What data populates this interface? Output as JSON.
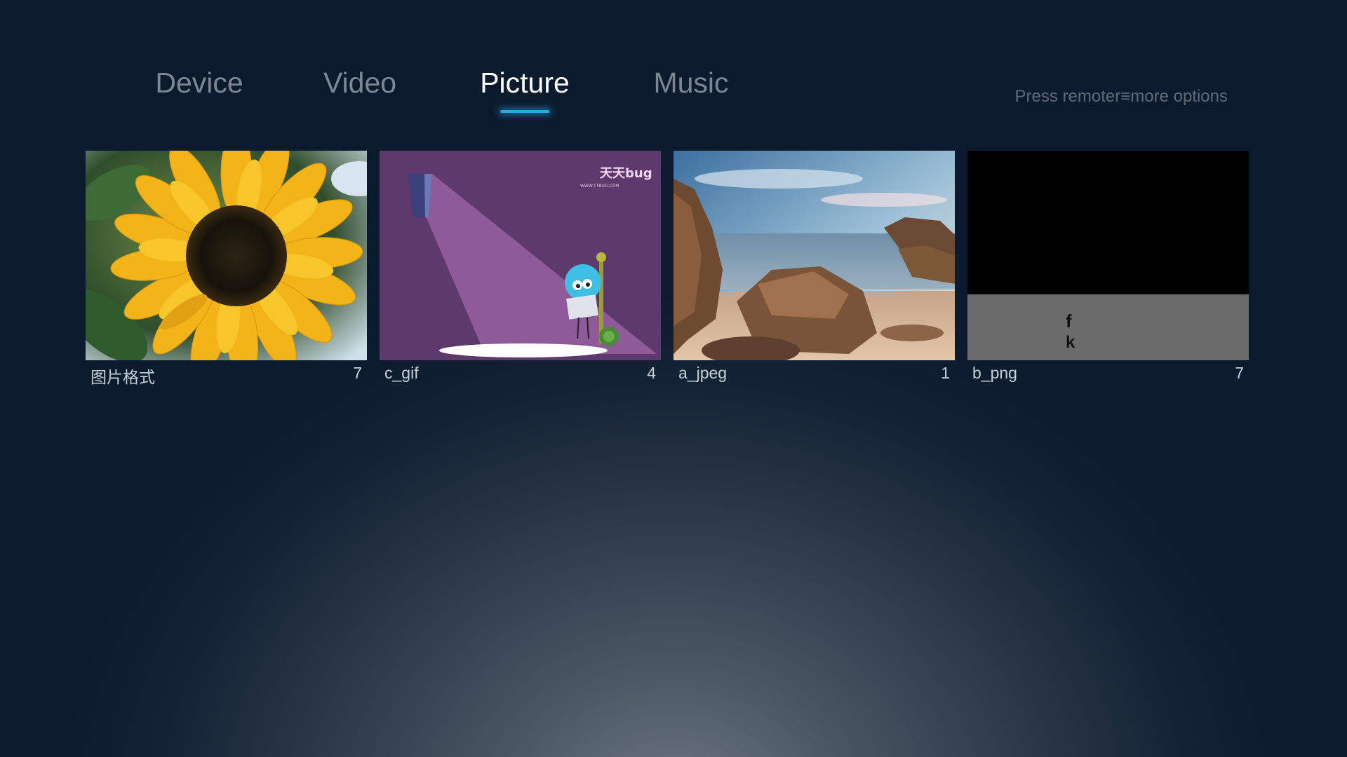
{
  "tabs": [
    {
      "label": "Device",
      "active": false
    },
    {
      "label": "Video",
      "active": false
    },
    {
      "label": "Picture",
      "active": true
    },
    {
      "label": "Music",
      "active": false
    }
  ],
  "hint": {
    "prefix": "Press remoter",
    "icon": "menu-icon",
    "suffix": "more options"
  },
  "folders": [
    {
      "title": "图片格式",
      "count": "7",
      "thumbnail": "sunflower-photo"
    },
    {
      "title": "c_gif",
      "count": "4",
      "thumbnail": "cartoon-spotlight-gif"
    },
    {
      "title": "a_jpeg",
      "count": "1",
      "thumbnail": "rocky-beach-photo"
    },
    {
      "title": "b_png",
      "count": "7",
      "thumbnail": "black-gray-png"
    }
  ],
  "thumb_text": {
    "gif_logo": "天天bug",
    "gif_url": "WWW.TTBUG.COM",
    "png_line1": "f",
    "png_line2": "k"
  },
  "colors": {
    "accent": "#2aa8e0",
    "active_tab": "#ffffff",
    "inactive_tab": "#7c8794"
  }
}
